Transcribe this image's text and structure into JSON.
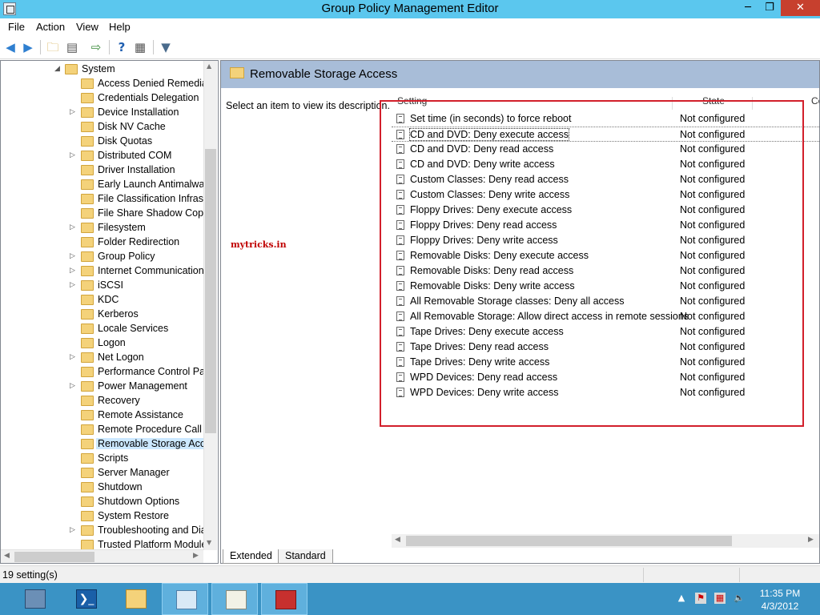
{
  "window": {
    "title": "Group Policy Management Editor",
    "minimize_icon": "minimize-icon",
    "maximize_icon": "restore-icon",
    "close_icon": "close-icon"
  },
  "menu": {
    "file": "File",
    "action": "Action",
    "view": "View",
    "help": "Help"
  },
  "toolbar": {
    "icons": [
      "back-arrow-icon",
      "forward-arrow-icon",
      "up-folder-icon",
      "show-hide-console-tree-icon",
      "export-list-icon",
      "help-icon",
      "properties-icon",
      "filter-icon"
    ]
  },
  "tree": {
    "parent": "System",
    "items": [
      {
        "label": "Access Denied Remediati",
        "expandable": false
      },
      {
        "label": "Credentials Delegation",
        "expandable": false
      },
      {
        "label": "Device Installation",
        "expandable": true
      },
      {
        "label": "Disk NV Cache",
        "expandable": false
      },
      {
        "label": "Disk Quotas",
        "expandable": false
      },
      {
        "label": "Distributed COM",
        "expandable": true
      },
      {
        "label": "Driver Installation",
        "expandable": false
      },
      {
        "label": "Early Launch Antimalwar",
        "expandable": false
      },
      {
        "label": "File Classification Infrastr",
        "expandable": false
      },
      {
        "label": "File Share Shadow Copy P",
        "expandable": false
      },
      {
        "label": "Filesystem",
        "expandable": true
      },
      {
        "label": "Folder Redirection",
        "expandable": false
      },
      {
        "label": "Group Policy",
        "expandable": true
      },
      {
        "label": "Internet Communication",
        "expandable": true
      },
      {
        "label": "iSCSI",
        "expandable": true
      },
      {
        "label": "KDC",
        "expandable": false
      },
      {
        "label": "Kerberos",
        "expandable": false
      },
      {
        "label": "Locale Services",
        "expandable": false
      },
      {
        "label": "Logon",
        "expandable": false
      },
      {
        "label": "Net Logon",
        "expandable": true
      },
      {
        "label": "Performance Control Pan",
        "expandable": false
      },
      {
        "label": "Power Management",
        "expandable": true
      },
      {
        "label": "Recovery",
        "expandable": false
      },
      {
        "label": "Remote Assistance",
        "expandable": false
      },
      {
        "label": "Remote Procedure Call",
        "expandable": false
      },
      {
        "label": "Removable Storage Acce",
        "expandable": false,
        "selected": true
      },
      {
        "label": "Scripts",
        "expandable": false
      },
      {
        "label": "Server Manager",
        "expandable": false
      },
      {
        "label": "Shutdown",
        "expandable": false
      },
      {
        "label": "Shutdown Options",
        "expandable": false
      },
      {
        "label": "System Restore",
        "expandable": false
      },
      {
        "label": "Troubleshooting and Dia",
        "expandable": true
      },
      {
        "label": "Trusted Platform Module",
        "expandable": false
      }
    ]
  },
  "details": {
    "header_title": "Removable Storage Access",
    "description": "Select an item to view its description.",
    "watermark": "mytricks.in",
    "columns": {
      "setting": "Setting",
      "state": "State",
      "comment": "Co"
    },
    "settings": [
      {
        "name": "Set time (in seconds) to force reboot",
        "state": "Not configured"
      },
      {
        "name": "CD and DVD: Deny execute access",
        "state": "Not configured"
      },
      {
        "name": "CD and DVD: Deny read access",
        "state": "Not configured"
      },
      {
        "name": "CD and DVD: Deny write access",
        "state": "Not configured"
      },
      {
        "name": "Custom Classes: Deny read access",
        "state": "Not configured"
      },
      {
        "name": "Custom Classes: Deny write access",
        "state": "Not configured"
      },
      {
        "name": "Floppy Drives: Deny execute access",
        "state": "Not configured"
      },
      {
        "name": "Floppy Drives: Deny read access",
        "state": "Not configured"
      },
      {
        "name": "Floppy Drives: Deny write access",
        "state": "Not configured"
      },
      {
        "name": "Removable Disks: Deny execute access",
        "state": "Not configured"
      },
      {
        "name": "Removable Disks: Deny read access",
        "state": "Not configured"
      },
      {
        "name": "Removable Disks: Deny write access",
        "state": "Not configured"
      },
      {
        "name": "All Removable Storage classes: Deny all access",
        "state": "Not configured"
      },
      {
        "name": "All Removable Storage: Allow direct access in remote sessions",
        "state": "Not configured"
      },
      {
        "name": "Tape Drives: Deny execute access",
        "state": "Not configured"
      },
      {
        "name": "Tape Drives: Deny read access",
        "state": "Not configured"
      },
      {
        "name": "Tape Drives: Deny write access",
        "state": "Not configured"
      },
      {
        "name": "WPD Devices: Deny read access",
        "state": "Not configured"
      },
      {
        "name": "WPD Devices: Deny write access",
        "state": "Not configured"
      }
    ],
    "highlight_color": "#d21f2b"
  },
  "tabs": {
    "extended": "Extended",
    "standard": "Standard"
  },
  "status": {
    "text": "19 setting(s)"
  },
  "taskbar": {
    "apps": [
      "server-manager-icon",
      "powershell-icon",
      "file-explorer-icon",
      "computer-management-icon",
      "group-policy-notepad-icon",
      "toolbox-icon"
    ],
    "clock_time": "11:35 PM",
    "clock_date": "4/3/2012"
  }
}
